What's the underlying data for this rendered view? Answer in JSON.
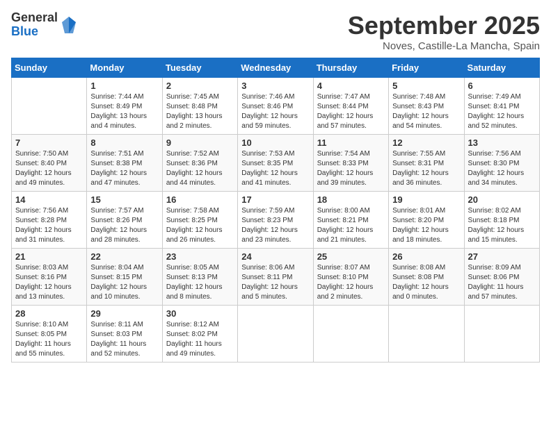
{
  "header": {
    "logo_general": "General",
    "logo_blue": "Blue",
    "title": "September 2025",
    "location": "Noves, Castille-La Mancha, Spain"
  },
  "days_of_week": [
    "Sunday",
    "Monday",
    "Tuesday",
    "Wednesday",
    "Thursday",
    "Friday",
    "Saturday"
  ],
  "weeks": [
    [
      {
        "day": "",
        "info": ""
      },
      {
        "day": "1",
        "info": "Sunrise: 7:44 AM\nSunset: 8:49 PM\nDaylight: 13 hours\nand 4 minutes."
      },
      {
        "day": "2",
        "info": "Sunrise: 7:45 AM\nSunset: 8:48 PM\nDaylight: 13 hours\nand 2 minutes."
      },
      {
        "day": "3",
        "info": "Sunrise: 7:46 AM\nSunset: 8:46 PM\nDaylight: 12 hours\nand 59 minutes."
      },
      {
        "day": "4",
        "info": "Sunrise: 7:47 AM\nSunset: 8:44 PM\nDaylight: 12 hours\nand 57 minutes."
      },
      {
        "day": "5",
        "info": "Sunrise: 7:48 AM\nSunset: 8:43 PM\nDaylight: 12 hours\nand 54 minutes."
      },
      {
        "day": "6",
        "info": "Sunrise: 7:49 AM\nSunset: 8:41 PM\nDaylight: 12 hours\nand 52 minutes."
      }
    ],
    [
      {
        "day": "7",
        "info": "Sunrise: 7:50 AM\nSunset: 8:40 PM\nDaylight: 12 hours\nand 49 minutes."
      },
      {
        "day": "8",
        "info": "Sunrise: 7:51 AM\nSunset: 8:38 PM\nDaylight: 12 hours\nand 47 minutes."
      },
      {
        "day": "9",
        "info": "Sunrise: 7:52 AM\nSunset: 8:36 PM\nDaylight: 12 hours\nand 44 minutes."
      },
      {
        "day": "10",
        "info": "Sunrise: 7:53 AM\nSunset: 8:35 PM\nDaylight: 12 hours\nand 41 minutes."
      },
      {
        "day": "11",
        "info": "Sunrise: 7:54 AM\nSunset: 8:33 PM\nDaylight: 12 hours\nand 39 minutes."
      },
      {
        "day": "12",
        "info": "Sunrise: 7:55 AM\nSunset: 8:31 PM\nDaylight: 12 hours\nand 36 minutes."
      },
      {
        "day": "13",
        "info": "Sunrise: 7:56 AM\nSunset: 8:30 PM\nDaylight: 12 hours\nand 34 minutes."
      }
    ],
    [
      {
        "day": "14",
        "info": "Sunrise: 7:56 AM\nSunset: 8:28 PM\nDaylight: 12 hours\nand 31 minutes."
      },
      {
        "day": "15",
        "info": "Sunrise: 7:57 AM\nSunset: 8:26 PM\nDaylight: 12 hours\nand 28 minutes."
      },
      {
        "day": "16",
        "info": "Sunrise: 7:58 AM\nSunset: 8:25 PM\nDaylight: 12 hours\nand 26 minutes."
      },
      {
        "day": "17",
        "info": "Sunrise: 7:59 AM\nSunset: 8:23 PM\nDaylight: 12 hours\nand 23 minutes."
      },
      {
        "day": "18",
        "info": "Sunrise: 8:00 AM\nSunset: 8:21 PM\nDaylight: 12 hours\nand 21 minutes."
      },
      {
        "day": "19",
        "info": "Sunrise: 8:01 AM\nSunset: 8:20 PM\nDaylight: 12 hours\nand 18 minutes."
      },
      {
        "day": "20",
        "info": "Sunrise: 8:02 AM\nSunset: 8:18 PM\nDaylight: 12 hours\nand 15 minutes."
      }
    ],
    [
      {
        "day": "21",
        "info": "Sunrise: 8:03 AM\nSunset: 8:16 PM\nDaylight: 12 hours\nand 13 minutes."
      },
      {
        "day": "22",
        "info": "Sunrise: 8:04 AM\nSunset: 8:15 PM\nDaylight: 12 hours\nand 10 minutes."
      },
      {
        "day": "23",
        "info": "Sunrise: 8:05 AM\nSunset: 8:13 PM\nDaylight: 12 hours\nand 8 minutes."
      },
      {
        "day": "24",
        "info": "Sunrise: 8:06 AM\nSunset: 8:11 PM\nDaylight: 12 hours\nand 5 minutes."
      },
      {
        "day": "25",
        "info": "Sunrise: 8:07 AM\nSunset: 8:10 PM\nDaylight: 12 hours\nand 2 minutes."
      },
      {
        "day": "26",
        "info": "Sunrise: 8:08 AM\nSunset: 8:08 PM\nDaylight: 12 hours\nand 0 minutes."
      },
      {
        "day": "27",
        "info": "Sunrise: 8:09 AM\nSunset: 8:06 PM\nDaylight: 11 hours\nand 57 minutes."
      }
    ],
    [
      {
        "day": "28",
        "info": "Sunrise: 8:10 AM\nSunset: 8:05 PM\nDaylight: 11 hours\nand 55 minutes."
      },
      {
        "day": "29",
        "info": "Sunrise: 8:11 AM\nSunset: 8:03 PM\nDaylight: 11 hours\nand 52 minutes."
      },
      {
        "day": "30",
        "info": "Sunrise: 8:12 AM\nSunset: 8:02 PM\nDaylight: 11 hours\nand 49 minutes."
      },
      {
        "day": "",
        "info": ""
      },
      {
        "day": "",
        "info": ""
      },
      {
        "day": "",
        "info": ""
      },
      {
        "day": "",
        "info": ""
      }
    ]
  ]
}
